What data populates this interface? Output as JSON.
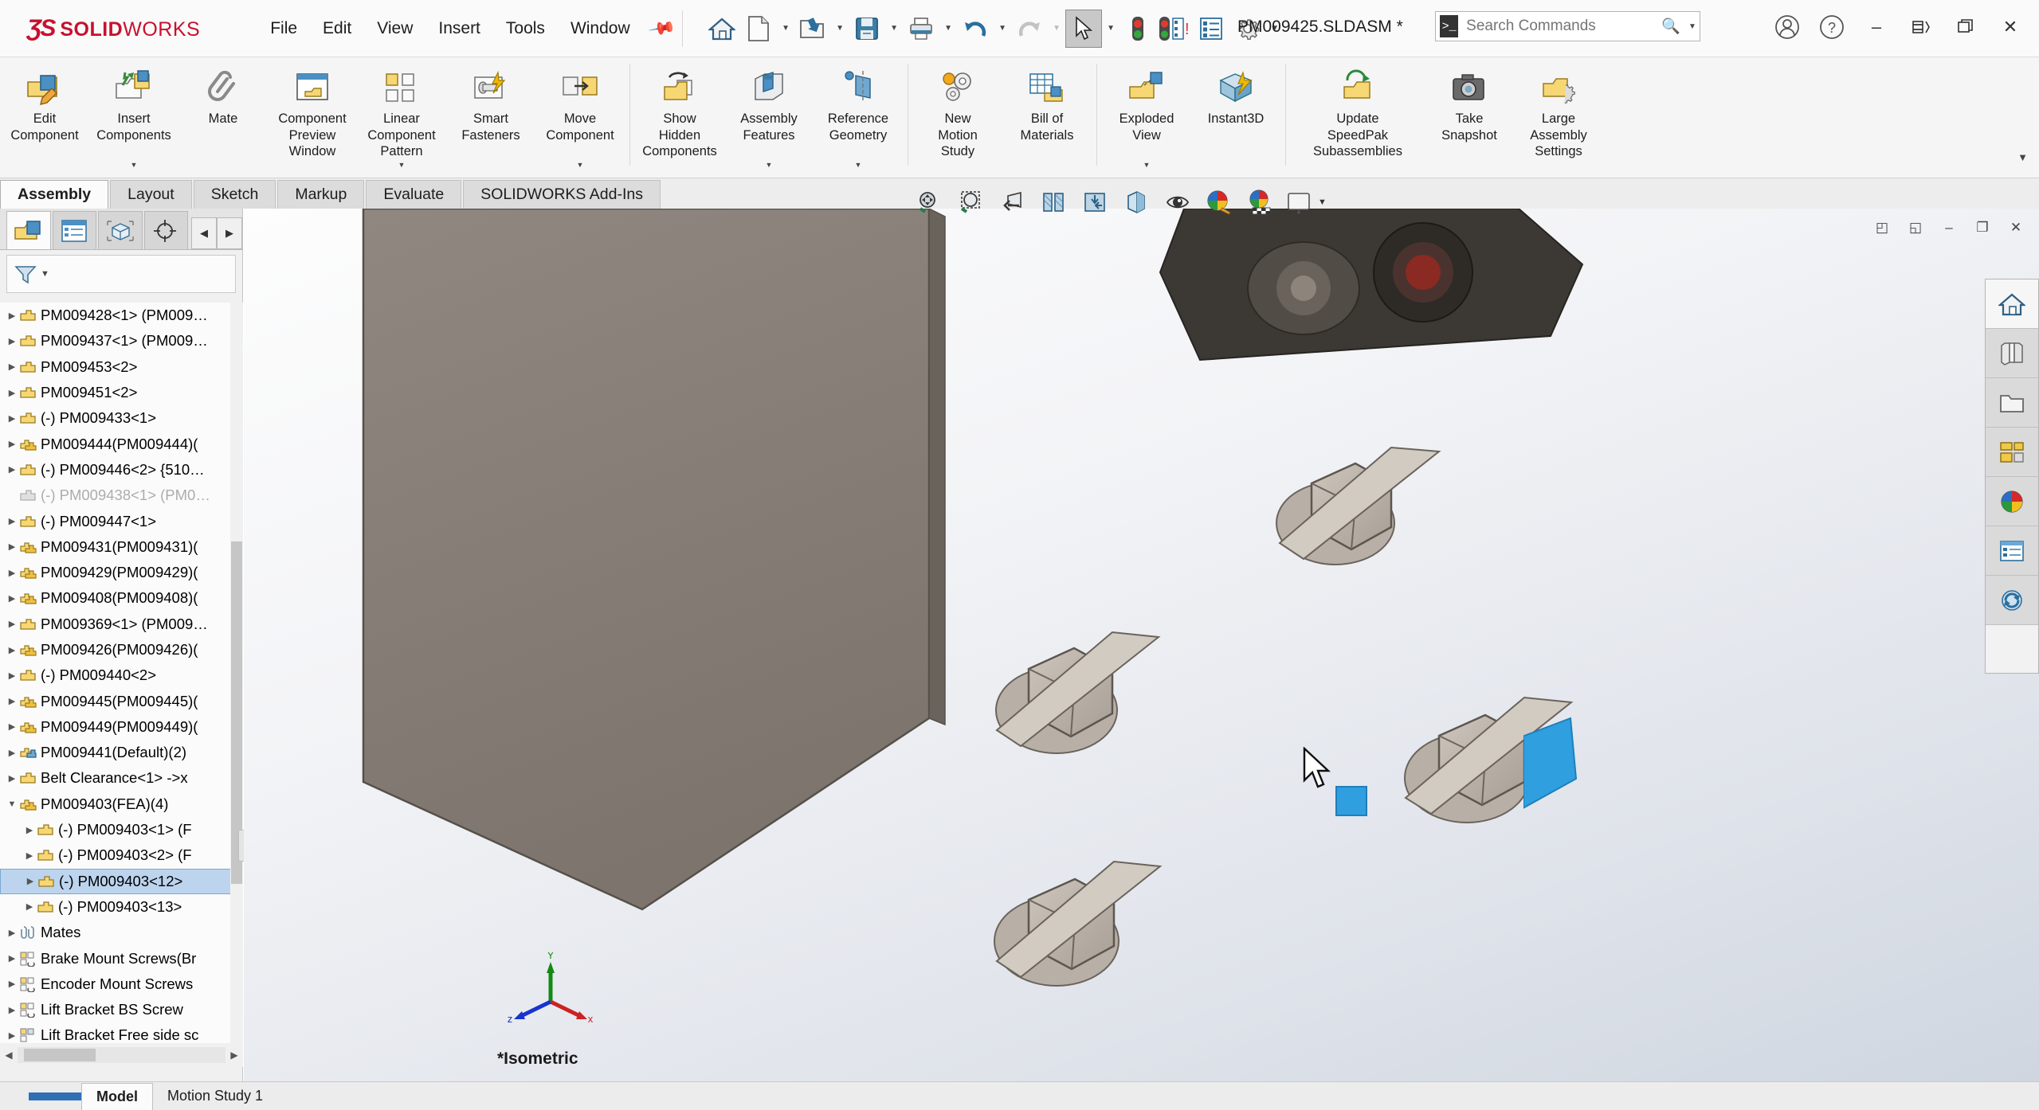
{
  "app": {
    "brand_mark": "ƷS",
    "brand_solid": "SOLID",
    "brand_works": "WORKS",
    "brand_color": "#c8102e",
    "document_title": "PM009425.SLDASM *"
  },
  "menu": {
    "items": [
      "File",
      "Edit",
      "View",
      "Insert",
      "Tools",
      "Window"
    ],
    "pin_icon": "pin-icon"
  },
  "quick_access": [
    {
      "name": "home-button",
      "icon": "home-icon",
      "caret": false
    },
    {
      "name": "new-document-button",
      "icon": "new-document-icon",
      "caret": true
    },
    {
      "name": "open-button",
      "icon": "open-folder-icon",
      "caret": true
    },
    {
      "name": "save-button",
      "icon": "save-disk-icon",
      "caret": true
    },
    {
      "name": "print-button",
      "icon": "printer-icon",
      "caret": true
    },
    {
      "name": "undo-button",
      "icon": "undo-arrow-icon",
      "caret": true
    },
    {
      "name": "redo-button",
      "icon": "redo-arrow-icon",
      "caret": true
    },
    {
      "name": "select-button",
      "icon": "cursor-arrow-icon",
      "caret": true,
      "active": true
    },
    {
      "name": "rebuild-button",
      "icon": "traffic-light-icon",
      "caret": false
    },
    {
      "name": "rebuild-all-button",
      "icon": "traffic-light-list-icon",
      "caret": false
    },
    {
      "name": "file-properties-button",
      "icon": "properties-list-icon",
      "caret": false
    },
    {
      "name": "options-button",
      "icon": "gear-icon",
      "caret": true
    }
  ],
  "search": {
    "placeholder": "Search Commands",
    "value": "",
    "prompt_icon": "command-prompt-icon",
    "magnifier_icon": "search-icon",
    "caret_icon": "chevron-down-icon"
  },
  "window_controls": {
    "account_icon": "user-account-icon",
    "help_icon": "help-question-icon",
    "minimize": "–",
    "restore": "❐",
    "maximize": "❐",
    "close": "✕"
  },
  "ribbon": {
    "groups": [
      {
        "buttons": [
          {
            "label": "Edit\nComponent",
            "icon": "edit-component-icon",
            "dropdown": false
          },
          {
            "label": "Insert\nComponents",
            "icon": "insert-components-icon",
            "dropdown": true
          },
          {
            "label": "Mate",
            "icon": "mate-paperclip-icon",
            "dropdown": false
          },
          {
            "label": "Component\nPreview\nWindow",
            "icon": "component-preview-icon",
            "dropdown": false
          },
          {
            "label": "Linear\nComponent\nPattern",
            "icon": "linear-pattern-icon",
            "dropdown": true
          },
          {
            "label": "Smart\nFasteners",
            "icon": "smart-fasteners-icon",
            "dropdown": false
          },
          {
            "label": "Move\nComponent",
            "icon": "move-component-icon",
            "dropdown": true
          }
        ]
      },
      {
        "buttons": [
          {
            "label": "Show\nHidden\nComponents",
            "icon": "show-hidden-icon",
            "dropdown": false
          },
          {
            "label": "Assembly\nFeatures",
            "icon": "assembly-features-icon",
            "dropdown": true
          },
          {
            "label": "Reference\nGeometry",
            "icon": "reference-geometry-icon",
            "dropdown": true
          }
        ]
      },
      {
        "buttons": [
          {
            "label": "New\nMotion\nStudy",
            "icon": "new-motion-study-icon",
            "dropdown": false
          },
          {
            "label": "Bill of\nMaterials",
            "icon": "bill-of-materials-icon",
            "dropdown": false
          }
        ]
      },
      {
        "buttons": [
          {
            "label": "Exploded\nView",
            "icon": "exploded-view-icon",
            "dropdown": true
          },
          {
            "label": "Instant3D",
            "icon": "instant3d-icon",
            "dropdown": false
          }
        ]
      },
      {
        "buttons": [
          {
            "label": "Update\nSpeedPak\nSubassemblies",
            "icon": "update-speedpak-icon",
            "dropdown": false
          },
          {
            "label": "Take\nSnapshot",
            "icon": "take-snapshot-icon",
            "dropdown": false
          },
          {
            "label": "Large\nAssembly\nSettings",
            "icon": "large-assembly-settings-icon",
            "dropdown": false
          }
        ]
      }
    ],
    "collapse_icon": "chevron-down-icon"
  },
  "command_tabs": {
    "items": [
      "Assembly",
      "Layout",
      "Sketch",
      "Markup",
      "Evaluate",
      "SOLIDWORKS Add-Ins"
    ],
    "active": "Assembly"
  },
  "feature_manager": {
    "tabs": [
      {
        "name": "feature-tree-tab",
        "icon": "feature-tree-icon",
        "active": true
      },
      {
        "name": "property-manager-tab",
        "icon": "property-manager-icon",
        "active": false
      },
      {
        "name": "configuration-manager-tab",
        "icon": "configuration-manager-icon",
        "active": false
      },
      {
        "name": "dimxpert-manager-tab",
        "icon": "dimxpert-icon",
        "active": false
      }
    ],
    "arrow_left": "◀",
    "arrow_right": "▶",
    "filter": {
      "icon": "filter-funnel-icon",
      "placeholder": "",
      "value": ""
    },
    "tree": [
      {
        "label": "PM009428<1> (PM009…",
        "icon": "part-icon",
        "twisty": "▶",
        "indent": 0,
        "state": "normal"
      },
      {
        "label": "PM009437<1> (PM009…",
        "icon": "part-icon",
        "twisty": "▶",
        "indent": 0,
        "state": "normal"
      },
      {
        "label": "PM009453<2>",
        "icon": "part-icon",
        "twisty": "▶",
        "indent": 0,
        "state": "normal"
      },
      {
        "label": "PM009451<2>",
        "icon": "part-icon",
        "twisty": "▶",
        "indent": 0,
        "state": "normal"
      },
      {
        "label": "(-) PM009433<1>",
        "icon": "part-icon",
        "twisty": "▶",
        "indent": 0,
        "state": "normal"
      },
      {
        "label": "PM009444(PM009444)(",
        "icon": "assembly-icon",
        "twisty": "▶",
        "indent": 0,
        "state": "normal"
      },
      {
        "label": "(-) PM009446<2> {510…",
        "icon": "part-icon",
        "twisty": "▶",
        "indent": 0,
        "state": "normal"
      },
      {
        "label": "(-) PM009438<1> (PM0…",
        "icon": "part-icon-grey",
        "twisty": "",
        "indent": 0,
        "state": "suppressed"
      },
      {
        "label": "(-) PM009447<1>",
        "icon": "part-icon",
        "twisty": "▶",
        "indent": 0,
        "state": "normal"
      },
      {
        "label": "PM009431(PM009431)(",
        "icon": "assembly-icon",
        "twisty": "▶",
        "indent": 0,
        "state": "normal"
      },
      {
        "label": "PM009429(PM009429)(",
        "icon": "assembly-icon",
        "twisty": "▶",
        "indent": 0,
        "state": "normal"
      },
      {
        "label": "PM009408(PM009408)(",
        "icon": "assembly-icon",
        "twisty": "▶",
        "indent": 0,
        "state": "normal"
      },
      {
        "label": "PM009369<1> (PM009…",
        "icon": "part-icon",
        "twisty": "▶",
        "indent": 0,
        "state": "normal"
      },
      {
        "label": "PM009426(PM009426)(",
        "icon": "assembly-icon",
        "twisty": "▶",
        "indent": 0,
        "state": "normal"
      },
      {
        "label": "(-) PM009440<2>",
        "icon": "part-icon",
        "twisty": "▶",
        "indent": 0,
        "state": "normal"
      },
      {
        "label": "PM009445(PM009445)(",
        "icon": "assembly-icon",
        "twisty": "▶",
        "indent": 0,
        "state": "normal"
      },
      {
        "label": "PM009449(PM009449)(",
        "icon": "assembly-icon",
        "twisty": "▶",
        "indent": 0,
        "state": "normal"
      },
      {
        "label": "PM009441(Default)(2)",
        "icon": "assembly-blue-icon",
        "twisty": "▶",
        "indent": 0,
        "state": "normal"
      },
      {
        "label": "Belt Clearance<1> ->x",
        "icon": "part-icon",
        "twisty": "▶",
        "indent": 0,
        "state": "normal"
      },
      {
        "label": "PM009403(FEA)(4)",
        "icon": "assembly-icon",
        "twisty": "▼",
        "indent": 0,
        "state": "expanded"
      },
      {
        "label": "(-) PM009403<1> (F",
        "icon": "part-icon",
        "twisty": "▶",
        "indent": 1,
        "state": "normal"
      },
      {
        "label": "(-) PM009403<2> (F",
        "icon": "part-icon",
        "twisty": "▶",
        "indent": 1,
        "state": "normal"
      },
      {
        "label": "(-) PM009403<12>",
        "icon": "part-icon",
        "twisty": "▶",
        "indent": 1,
        "state": "selected"
      },
      {
        "label": "(-) PM009403<13>",
        "icon": "part-icon",
        "twisty": "▶",
        "indent": 1,
        "state": "normal"
      },
      {
        "label": "Mates",
        "icon": "mates-paperclip-icon",
        "twisty": "▶",
        "indent": 0,
        "state": "normal"
      },
      {
        "label": "Brake Mount Screws(Br",
        "icon": "folder-pattern-icon",
        "twisty": "▶",
        "indent": 0,
        "state": "normal"
      },
      {
        "label": "Encoder Mount Screws",
        "icon": "folder-pattern-icon",
        "twisty": "▶",
        "indent": 0,
        "state": "normal"
      },
      {
        "label": "Lift Bracket BS Screw",
        "icon": "folder-pattern-icon",
        "twisty": "▶",
        "indent": 0,
        "state": "normal"
      },
      {
        "label": "Lift Bracket Free side sc",
        "icon": "folder-pattern-icon",
        "twisty": "▶",
        "indent": 0,
        "state": "normal"
      }
    ],
    "scroll_up_icon": "chevron-up-icon"
  },
  "viewport": {
    "view_label": "*Isometric",
    "triad": {
      "x_label": "x",
      "y_label": "Y",
      "z_label": "z",
      "x_color": "#cc2222",
      "y_color": "#128a12",
      "z_color": "#1a33cc"
    },
    "window_buttons": [
      {
        "name": "restore-down-left-icon",
        "glyph": "◰"
      },
      {
        "name": "tile-icon",
        "glyph": "◱"
      },
      {
        "name": "minimize-doc-icon",
        "glyph": "–"
      },
      {
        "name": "maximize-doc-icon",
        "glyph": "❐"
      },
      {
        "name": "close-doc-icon",
        "glyph": "✕"
      }
    ],
    "heads_up": [
      {
        "name": "zoom-to-fit-icon"
      },
      {
        "name": "zoom-to-area-icon"
      },
      {
        "name": "previous-view-icon"
      },
      {
        "name": "section-view-icon"
      },
      {
        "name": "view-orientation-icon"
      },
      {
        "name": "display-style-icon"
      },
      {
        "name": "hide-show-items-icon"
      },
      {
        "name": "edit-appearance-icon"
      },
      {
        "name": "apply-scene-icon"
      },
      {
        "name": "view-settings-icon"
      }
    ],
    "selection": {
      "cursor_icon": "mouse-pointer-icon",
      "selected_face_color": "#2f9fe0",
      "marker_name": "face-selection-marker"
    },
    "model_color": "#8a8078"
  },
  "task_pane": [
    {
      "name": "sw-resources-button",
      "icon": "home-icon"
    },
    {
      "name": "design-library-button",
      "icon": "library-books-icon"
    },
    {
      "name": "file-explorer-button",
      "icon": "folder-icon"
    },
    {
      "name": "view-palette-button",
      "icon": "view-palette-icon"
    },
    {
      "name": "appearances-scenes-button",
      "icon": "appearances-sphere-icon"
    },
    {
      "name": "custom-properties-button",
      "icon": "custom-properties-icon"
    },
    {
      "name": "pdm-button",
      "icon": "refresh-circle-icon"
    }
  ],
  "status_bar": {
    "tabs": [
      "Model",
      "Motion Study 1"
    ],
    "active": "Model"
  }
}
